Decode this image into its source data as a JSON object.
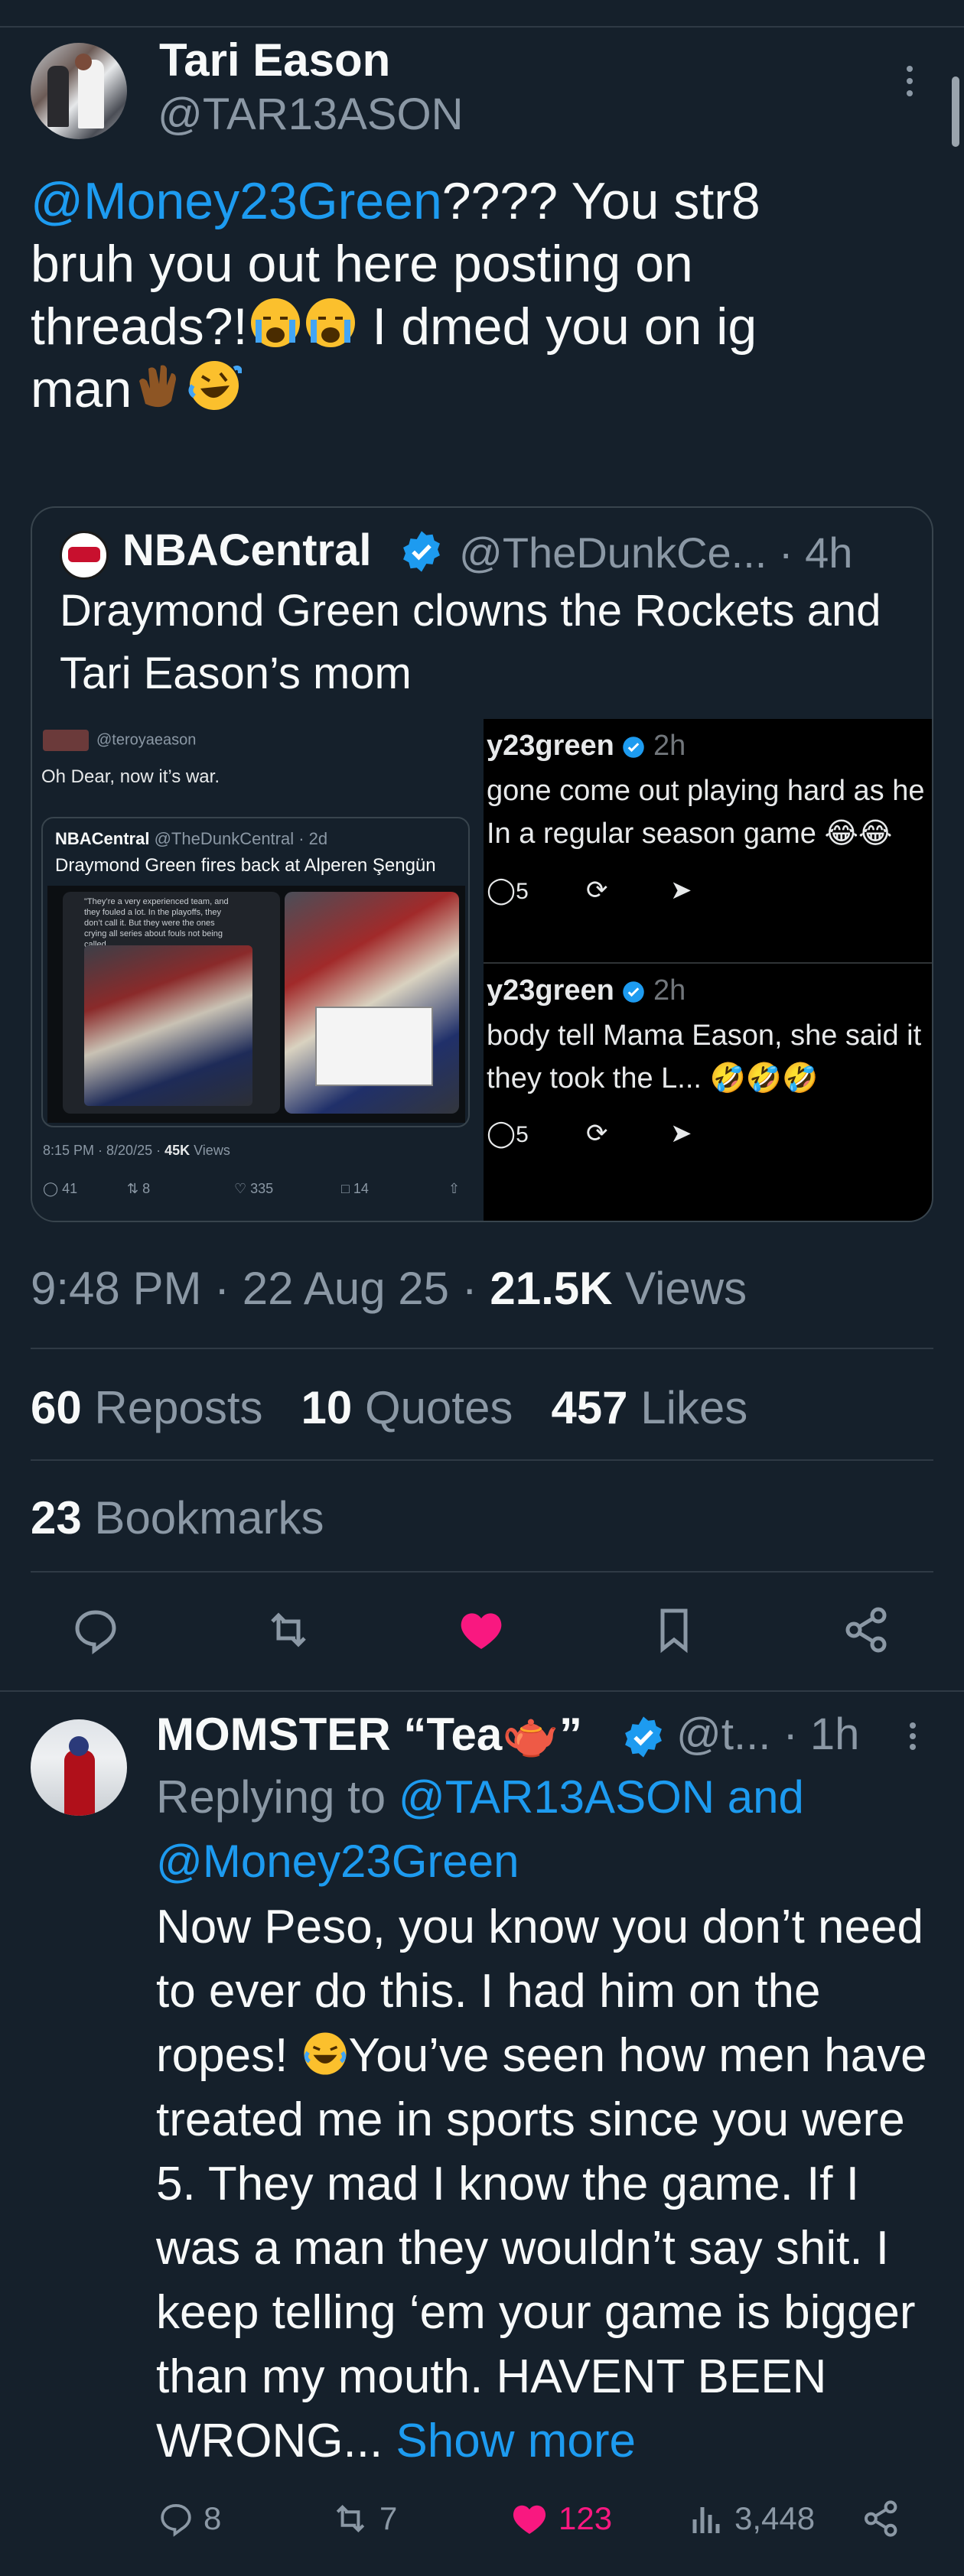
{
  "tweet": {
    "author_name": "Tari Eason",
    "author_handle": "@TAR13ASON",
    "mention": "@Money23Green",
    "text_line1_rest": "???? You str8",
    "text_line2": "bruh you out here posting on",
    "text_line3a": "threads?!",
    "text_line3b": " I dmed you on ig",
    "text_line4": "man",
    "timestamp": "9:48 PM · 22 Aug 25 · ",
    "views_count": "21.5K",
    "views_label": " Views",
    "reposts_count": "60",
    "reposts_label": "Reposts",
    "quotes_count": "10",
    "quotes_label": "Quotes",
    "likes_count": "457",
    "likes_label": "Likes",
    "bookmarks_count": "23",
    "bookmarks_label": "Bookmarks"
  },
  "quote": {
    "name": "NBACentral",
    "handle": "@TheDunkCe... · 4h",
    "text": "Draymond Green clowns the Rockets and Tari Eason’s mom",
    "left": {
      "handle": "@teroyaeason",
      "text": "Oh Dear, now it’s war.",
      "inner_name": "NBACentral",
      "inner_handle": "@TheDunkCentral · 2d",
      "inner_text": "Draymond Green fires back at Alperen Şengün",
      "inner_quote": "\"They’re a very experienced team, and they fouled a lot. In the playoffs, they don’t call it. But they were the ones crying all series about fouls not being called...",
      "meta_time": "8:15 PM · 8/20/25 · ",
      "meta_views": "45K",
      "meta_views_label": " Views",
      "replies": "41",
      "reposts": "8",
      "likes": "335",
      "bookmarks": "14"
    },
    "right": {
      "post1_handle": "y23green",
      "post1_time": " 2h",
      "post1_line1": "gone come out playing hard as he",
      "post1_line2": "In a regular season game",
      "post1_replies": "5",
      "post2_handle": "y23green",
      "post2_time": " 2h",
      "post2_line1": "body tell Mama Eason, she said it",
      "post2_line2": " they took the L...",
      "post2_replies": "5"
    }
  },
  "reply": {
    "name": "MOMSTER “Tea",
    "name_end": "”",
    "handle": "@t...  · 1h",
    "replying_prefix": "Replying to ",
    "replying_to": "@TAR13ASON and @Money23Green",
    "text_a": "Now Peso, you know you don’t need to ever do this.  I had him on the ropes! ",
    "text_b": "You’ve seen how men have treated me in sports since you were 5. They mad I know the game. If I was a man they wouldn’t say shit. I keep telling ‘em your game is bigger than my mouth. HAVENT BEEN WRONG... ",
    "show_more": "Show more",
    "replies": "8",
    "reposts": "7",
    "likes": "123",
    "views": "3,448"
  },
  "colors": {
    "background": "#15202b",
    "accent": "#1d9bf0",
    "like": "#f91880",
    "muted": "#8b98a5"
  },
  "icons": [
    "more-vertical-icon",
    "verified-icon",
    "reply-icon",
    "repost-icon",
    "heart-icon",
    "bookmark-icon",
    "share-icon",
    "views-icon",
    "emoji-cry-icon",
    "emoji-clap-icon",
    "emoji-laugh-icon"
  ]
}
